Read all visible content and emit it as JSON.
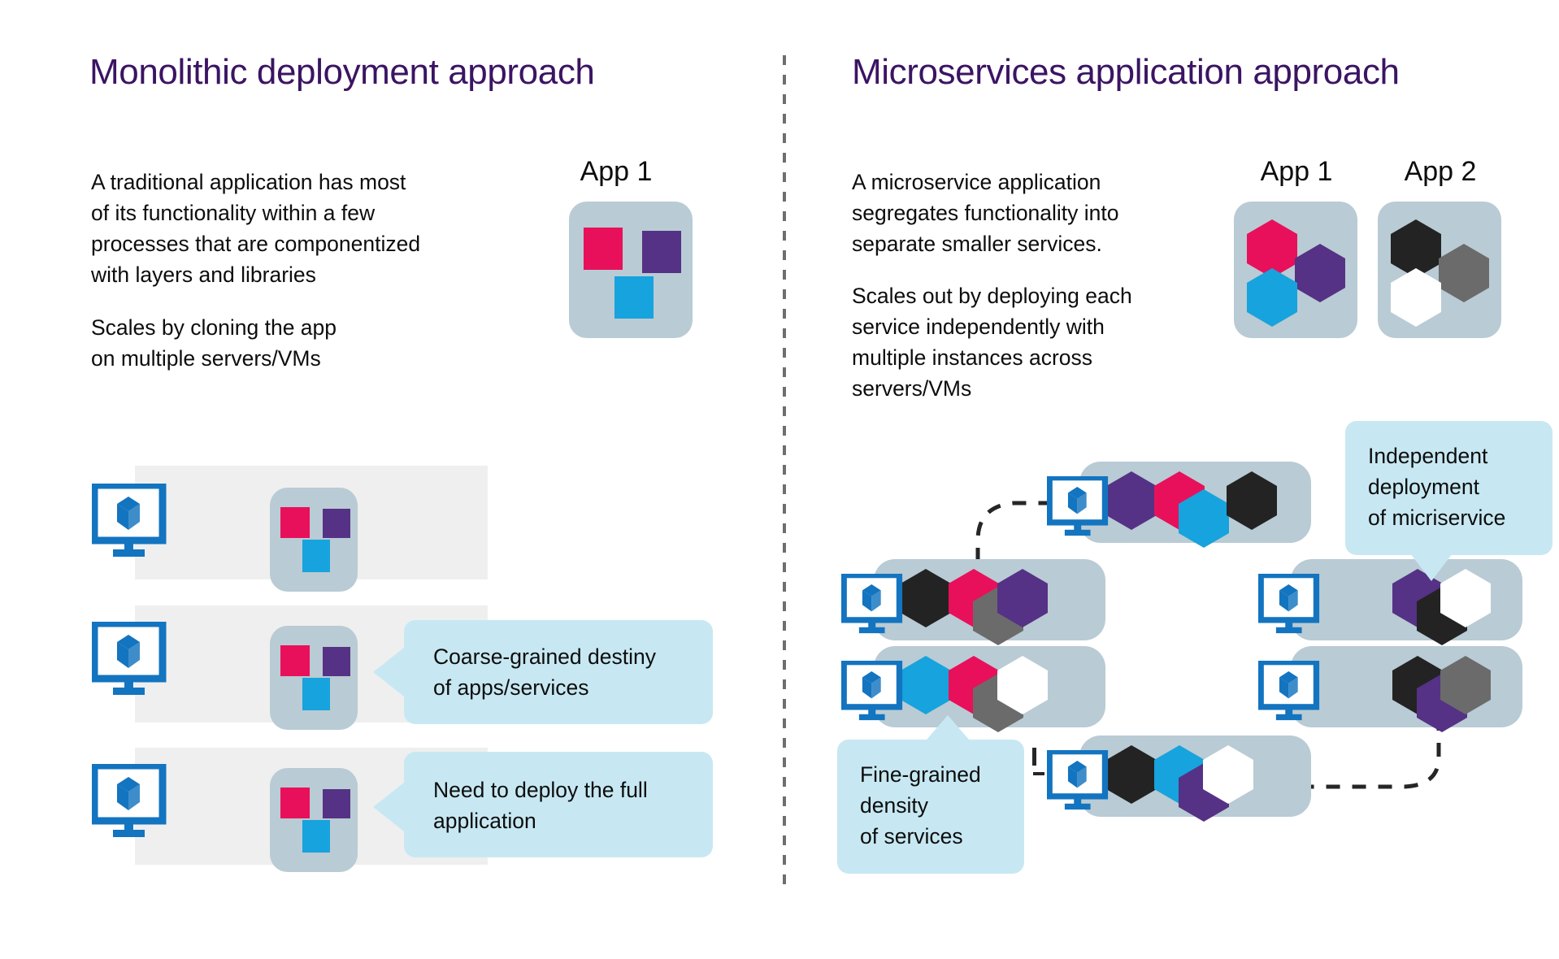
{
  "colors": {
    "title_purple": "#3b1463",
    "red": "#e8105a",
    "purple": "#553285",
    "blue": "#17a3dd",
    "black": "#232323",
    "grey": "#6b6b6b",
    "white": "#ffffff",
    "tile_grey": "#b9cbd4",
    "band_grey": "#efefef",
    "callout_blue": "#c7e8f2",
    "monitor_blue": "#1374c0"
  },
  "left_panel": {
    "title": "Monolithic deployment approach",
    "paragraph_1": "A traditional application has most\nof its functionality within a few\nprocesses that are componentized\nwith layers and libraries",
    "paragraph_2": "Scales by cloning the app\non multiple servers/VMs",
    "app_label": "App 1",
    "app_tile_squares": [
      "red",
      "purple",
      "blue"
    ],
    "server_rows": [
      {
        "index": 1,
        "callout": null
      },
      {
        "index": 2,
        "callout": "Coarse-grained destiny\nof apps/services"
      },
      {
        "index": 3,
        "callout": "Need to deploy the full\napplication"
      }
    ]
  },
  "right_panel": {
    "title": "Microservices application approach",
    "paragraph_1": "A microservice application\nsegregates functionality into\nseparate smaller services.",
    "paragraph_2": "Scales out by deploying each\nservice independently with\nmultiple instances across\nservers/VMs",
    "apps": [
      {
        "label": "App 1",
        "hexes": [
          "red",
          "purple",
          "blue"
        ]
      },
      {
        "label": "App 2",
        "hexes": [
          "black",
          "grey",
          "white"
        ]
      }
    ],
    "callout_independent": "Independent\ndeployment\nof micriservice",
    "callout_fine_grained": "Fine-grained\ndensity\nof services",
    "clusters": [
      {
        "id": "cluster-top",
        "hexes": [
          "purple",
          "red",
          "blue",
          "black"
        ]
      },
      {
        "id": "cluster-mid-left",
        "hexes": [
          "black",
          "red",
          "grey",
          "purple"
        ]
      },
      {
        "id": "cluster-mid-right",
        "hexes": [
          "purple",
          "black",
          "white"
        ]
      },
      {
        "id": "cluster-low-left",
        "hexes": [
          "blue",
          "red",
          "grey",
          "white"
        ]
      },
      {
        "id": "cluster-low-right",
        "hexes": [
          "black",
          "purple",
          "grey"
        ]
      },
      {
        "id": "cluster-bottom",
        "hexes": [
          "black",
          "blue",
          "purple",
          "white"
        ]
      }
    ]
  },
  "icons": {
    "monitor": "monitor-with-cube-icon",
    "cube": "cube-icon",
    "hexagon": "hexagon-icon",
    "square": "square-icon"
  }
}
